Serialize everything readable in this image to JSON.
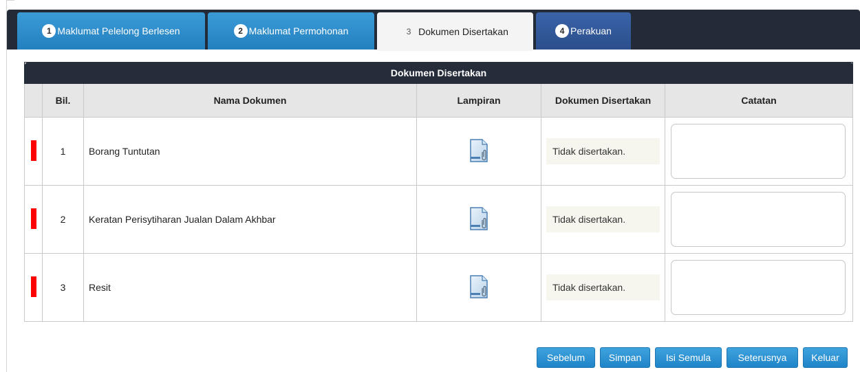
{
  "tabs": [
    {
      "num": "1",
      "label": "Maklumat Pelelong Berlesen"
    },
    {
      "num": "2",
      "label": "Maklumat Permohonan"
    },
    {
      "num": "3",
      "label": "Dokumen Disertakan"
    },
    {
      "num": "4",
      "label": "Perakuan"
    }
  ],
  "active_tab": 3,
  "table": {
    "caption": "Dokumen Disertakan",
    "headers": {
      "bil": "Bil.",
      "nama": "Nama Dokumen",
      "lampiran": "Lampiran",
      "disertakan": "Dokumen Disertakan",
      "catatan": "Catatan"
    },
    "rows": [
      {
        "bil": "1",
        "nama": "Borang Tuntutan",
        "status": "Tidak disertakan.",
        "catatan": ""
      },
      {
        "bil": "2",
        "nama": "Keratan Perisytiharan Jualan Dalam Akhbar",
        "status": "Tidak disertakan.",
        "catatan": ""
      },
      {
        "bil": "3",
        "nama": "Resit",
        "status": "Tidak disertakan.",
        "catatan": ""
      }
    ]
  },
  "buttons": {
    "prev": "Sebelum",
    "save": "Simpan",
    "reset": "Isi Semula",
    "next": "Seterusnya",
    "exit": "Keluar"
  },
  "colors": {
    "tab_bar": "#232b39",
    "tab_blue": "#2a8bcc",
    "tab_dark": "#2f5596",
    "required_marker": "#ff0000",
    "button": "#2a8bcc"
  },
  "icons": {
    "attachment": "document-attachment-icon"
  }
}
